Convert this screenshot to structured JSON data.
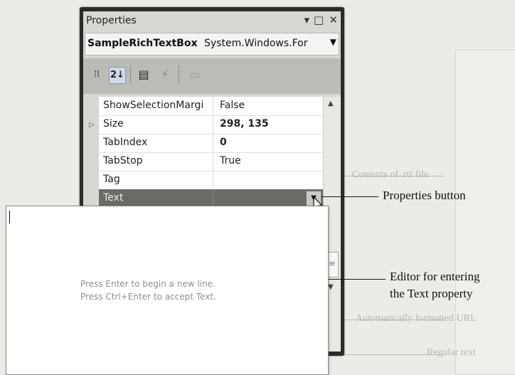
{
  "background": {
    "lines": [
      "Contents of .rtf file",
      "Automatically formatted URL",
      "Regular text"
    ]
  },
  "window": {
    "title": "Properties",
    "controls": {
      "dropdown": "▾",
      "maximize": "□",
      "close": "✕"
    },
    "object_name": "SampleRichTextBox",
    "object_type": "System.Windows.For",
    "toolbar": {
      "buttons": [
        {
          "name": "categorized-icon",
          "glyph": "⁝⁞"
        },
        {
          "name": "alphabetical-icon",
          "glyph": "2↓"
        },
        {
          "name": "properties-icon",
          "glyph": "▤"
        },
        {
          "name": "events-icon",
          "glyph": "⚡"
        },
        {
          "name": "property-pages-icon",
          "glyph": "▭"
        }
      ]
    },
    "properties": [
      {
        "name": "ShowSelectionMargi",
        "value": "False",
        "bold": false,
        "expander": false,
        "selected": false
      },
      {
        "name": "Size",
        "value": "298, 135",
        "bold": true,
        "expander": true,
        "selected": false
      },
      {
        "name": "TabIndex",
        "value": "0",
        "bold": true,
        "expander": false,
        "selected": false
      },
      {
        "name": "TabStop",
        "value": "True",
        "bold": false,
        "expander": false,
        "selected": false
      },
      {
        "name": "Tag",
        "value": "",
        "bold": false,
        "expander": false,
        "selected": false
      },
      {
        "name": "Text",
        "value": "",
        "bold": false,
        "expander": false,
        "selected": true
      }
    ]
  },
  "editor": {
    "hint_line1": "Press Enter to begin a new line.",
    "hint_line2": "Press Ctrl+Enter to accept Text."
  },
  "callouts": {
    "properties_button": "Properties button",
    "editor_line1": "Editor for entering",
    "editor_line2": "the Text property"
  }
}
